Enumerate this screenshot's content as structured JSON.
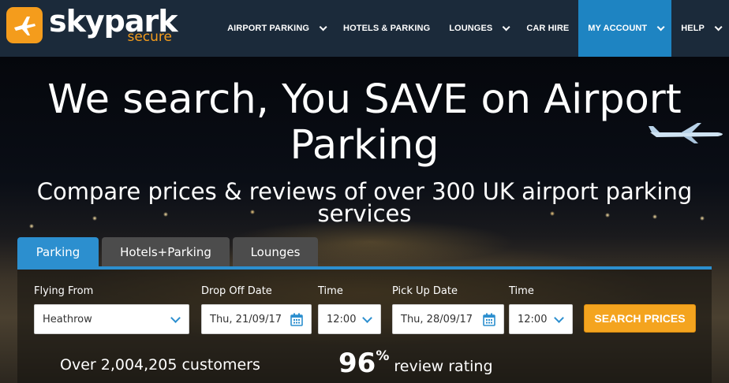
{
  "brand": {
    "name": "skypark",
    "tagline": "secure",
    "accent_color": "#f49c1c",
    "icon": "airplane-icon"
  },
  "nav": {
    "items": [
      {
        "label": "AIRPORT PARKING",
        "has_dropdown": true
      },
      {
        "label": "HOTELS & PARKING",
        "has_dropdown": false
      },
      {
        "label": "LOUNGES",
        "has_dropdown": true
      },
      {
        "label": "CAR HIRE",
        "has_dropdown": false
      },
      {
        "label": "MY ACCOUNT",
        "has_dropdown": true,
        "highlighted": true
      },
      {
        "label": "HELP",
        "has_dropdown": true
      }
    ],
    "highlight_color": "#1e84c2"
  },
  "hero": {
    "headline": "We search, You SAVE on Airport Parking",
    "subheadline": "Compare prices & reviews of over 300 UK airport parking services"
  },
  "tabs": [
    {
      "label": "Parking",
      "active": true
    },
    {
      "label": "Hotels+Parking",
      "active": false
    },
    {
      "label": "Lounges",
      "active": false
    }
  ],
  "form": {
    "flying_from": {
      "label": "Flying From",
      "value": "Heathrow"
    },
    "drop_off_date": {
      "label": "Drop Off Date",
      "value": "Thu, 21/09/17"
    },
    "drop_off_time": {
      "label": "Time",
      "value": "12:00"
    },
    "pick_up_date": {
      "label": "Pick Up Date",
      "value": "Thu, 28/09/17"
    },
    "pick_up_time": {
      "label": "Time",
      "value": "12:00"
    },
    "search_button": "SEARCH PRICES",
    "button_color": "#f4a41f"
  },
  "stats": {
    "customers": "Over 2,004,205 customers",
    "rating_number": "96",
    "rating_sign": "%",
    "rating_label": "review rating"
  }
}
